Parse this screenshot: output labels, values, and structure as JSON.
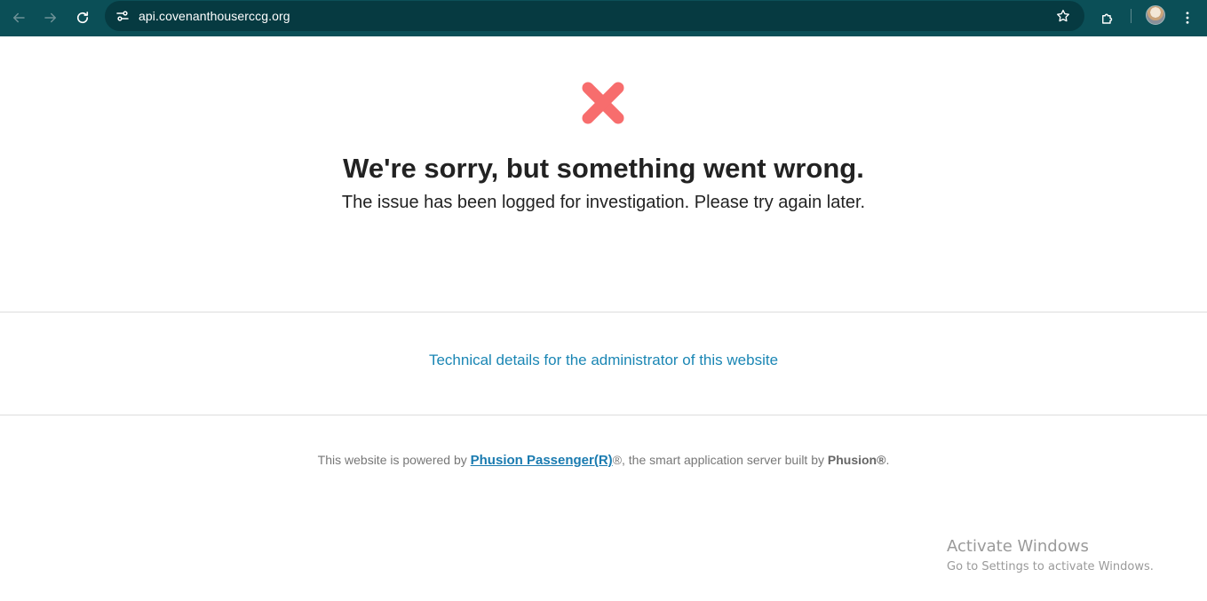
{
  "browser": {
    "url": "api.covenanthouserccg.org",
    "toolbar_icons": [
      "back-icon",
      "forward-icon",
      "reload-icon",
      "site-info-icon",
      "bookmark-star-icon",
      "extensions-icon",
      "profile-avatar",
      "menu-icon"
    ],
    "colors": {
      "toolbar": "#0b4f57",
      "omnibox": "#063a41"
    }
  },
  "page": {
    "headline": "We're sorry, but something went wrong.",
    "subline": "The issue has been logged for investigation. Please try again later.",
    "tech_details_link": "Technical details for the administrator of this website",
    "powered_prefix": "This website is powered by ",
    "powered_product": "Phusion Passenger(R)",
    "powered_middle": "®, the smart application server built by ",
    "powered_company": "Phusion®",
    "powered_suffix": ".",
    "colors": {
      "error_x": "#f76d6d",
      "link": "#1a86b4"
    }
  },
  "watermark": {
    "title": "Activate Windows",
    "subtitle": "Go to Settings to activate Windows."
  }
}
